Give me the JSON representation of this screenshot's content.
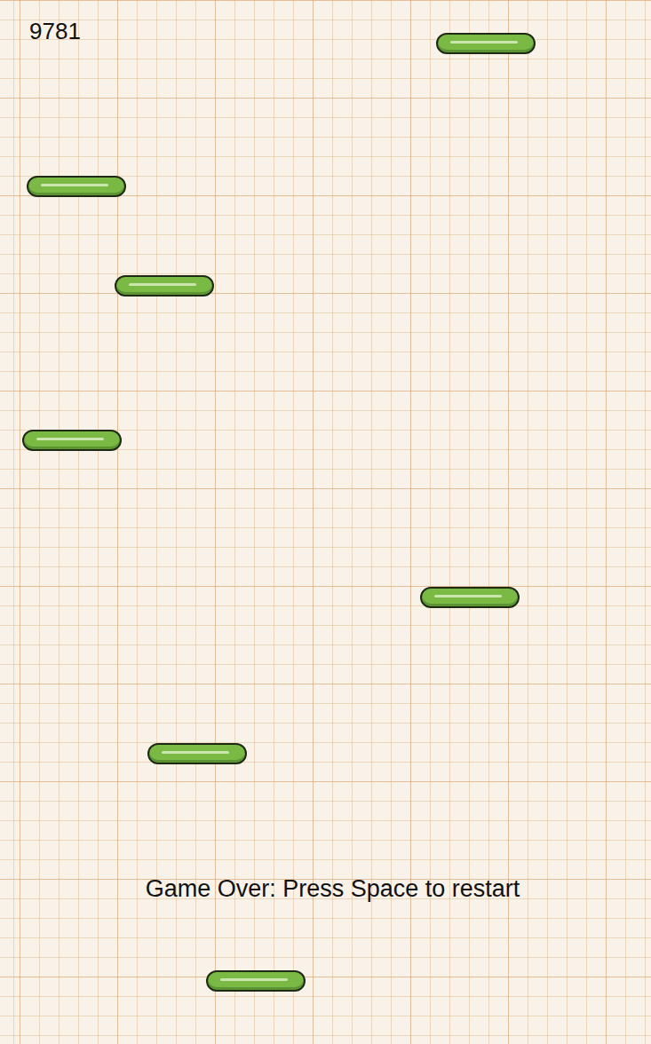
{
  "hud": {
    "score": "9781"
  },
  "overlay": {
    "message": "Game Over: Press Space to restart"
  }
}
